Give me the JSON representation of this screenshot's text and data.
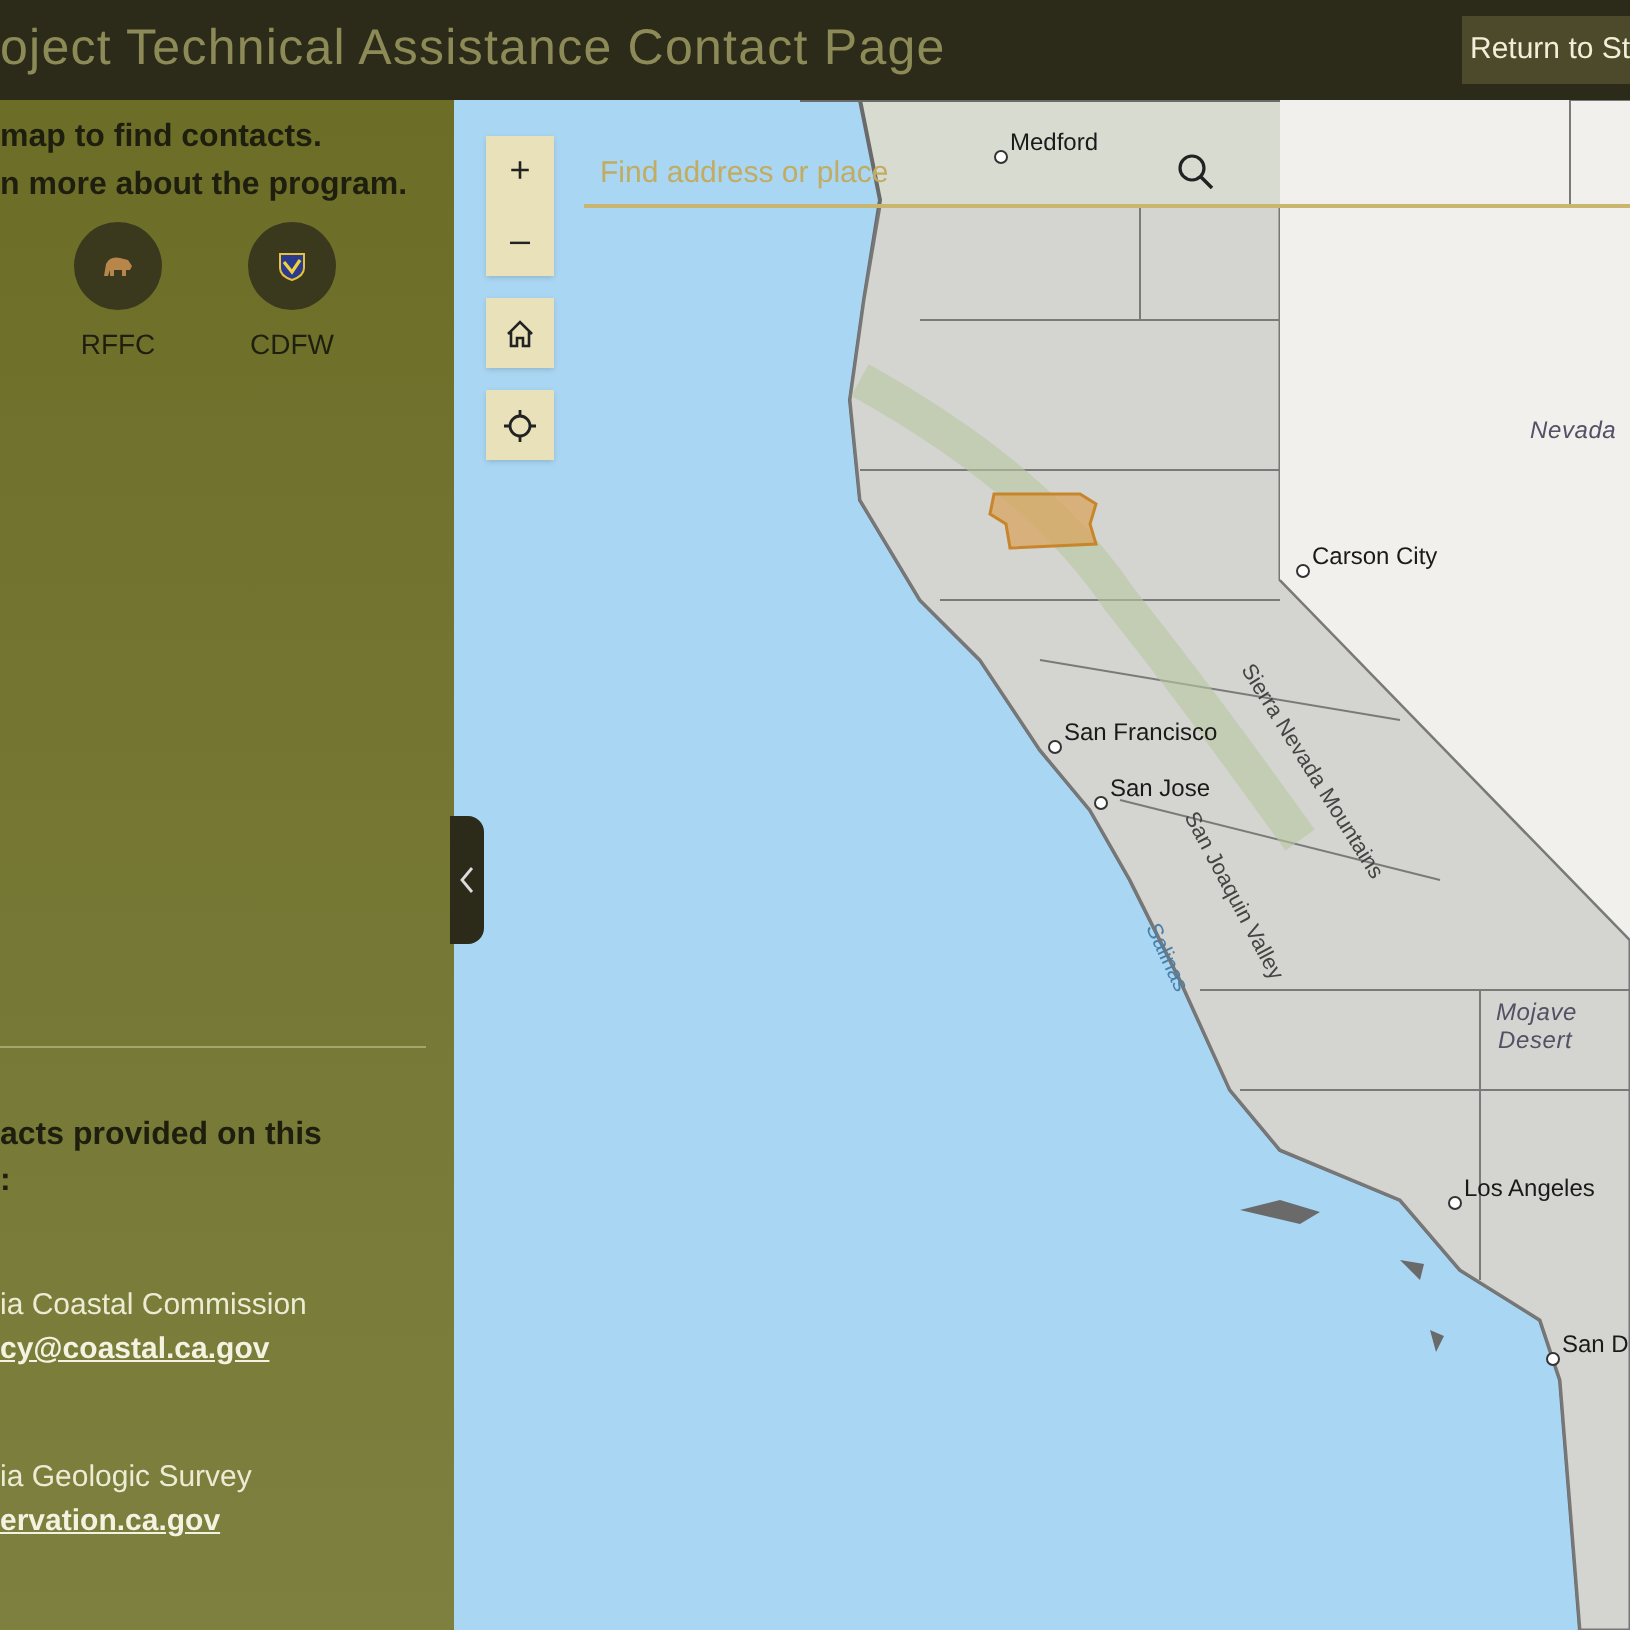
{
  "header": {
    "title": "oject Technical Assistance Contact Page",
    "return_button": "Return to St"
  },
  "sidebar": {
    "intro": [
      "map to find contacts.",
      "n more about the program."
    ],
    "agencies": [
      {
        "label": "RFFC",
        "kind": "bear"
      },
      {
        "label": "CDFW",
        "kind": "shield"
      }
    ],
    "contacts_heading": [
      "acts provided on this",
      ":"
    ],
    "contacts": [
      {
        "name": "ia Coastal Commission",
        "email": "cy@coastal.ca.gov"
      },
      {
        "name": "ia Geologic Survey",
        "email": "ervation.ca.gov"
      }
    ]
  },
  "map": {
    "search": {
      "placeholder": "Find address or place"
    },
    "controls": [
      {
        "kind": "zoom_in",
        "label": "+"
      },
      {
        "kind": "zoom_out",
        "label": "–"
      },
      {
        "kind": "home"
      },
      {
        "kind": "locate"
      }
    ],
    "labels": [
      {
        "text": "Medford",
        "kind": "city"
      },
      {
        "text": "Nevada",
        "kind": "region"
      },
      {
        "text": "Carson City",
        "kind": "city"
      },
      {
        "text": "San Francisco",
        "kind": "city"
      },
      {
        "text": "San Jose",
        "kind": "city"
      },
      {
        "text": "Sierra Nevada Mountains",
        "kind": "feature"
      },
      {
        "text": "San Joaquin Valley",
        "kind": "feature"
      },
      {
        "text": "Salinas",
        "kind": "river"
      },
      {
        "text": "Mojave",
        "kind": "region"
      },
      {
        "text": "Desert",
        "kind": "region"
      },
      {
        "text": "Los Angeles",
        "kind": "city"
      },
      {
        "text": "San D",
        "kind": "city"
      }
    ]
  }
}
